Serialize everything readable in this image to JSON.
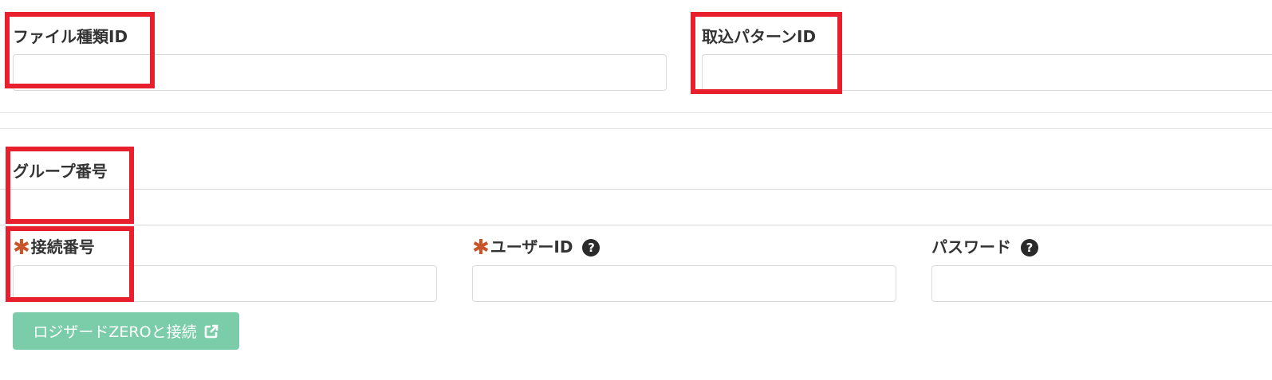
{
  "fields": {
    "file_type_id": {
      "label": "ファイル種類ID",
      "value": "",
      "placeholder": ""
    },
    "import_pattern_id": {
      "label": "取込パターンID",
      "value": "",
      "placeholder": ""
    },
    "group_number": {
      "label": "グループ番号",
      "value": "",
      "placeholder": ""
    },
    "connection_number": {
      "label": "接続番号",
      "value": "",
      "placeholder": "",
      "required_mark": "✱"
    },
    "user_id": {
      "label": "ユーザーID",
      "value": "",
      "placeholder": "",
      "required_mark": "✱",
      "help": "?"
    },
    "password": {
      "label": "パスワード",
      "value": "",
      "placeholder": "",
      "help": "?"
    }
  },
  "connect_button": {
    "label": "ロジザードZEROと接続",
    "icon": "external-link-icon"
  },
  "colors": {
    "highlight": "#e8202e",
    "required": "#c8562a",
    "button": "#7bcda9"
  }
}
